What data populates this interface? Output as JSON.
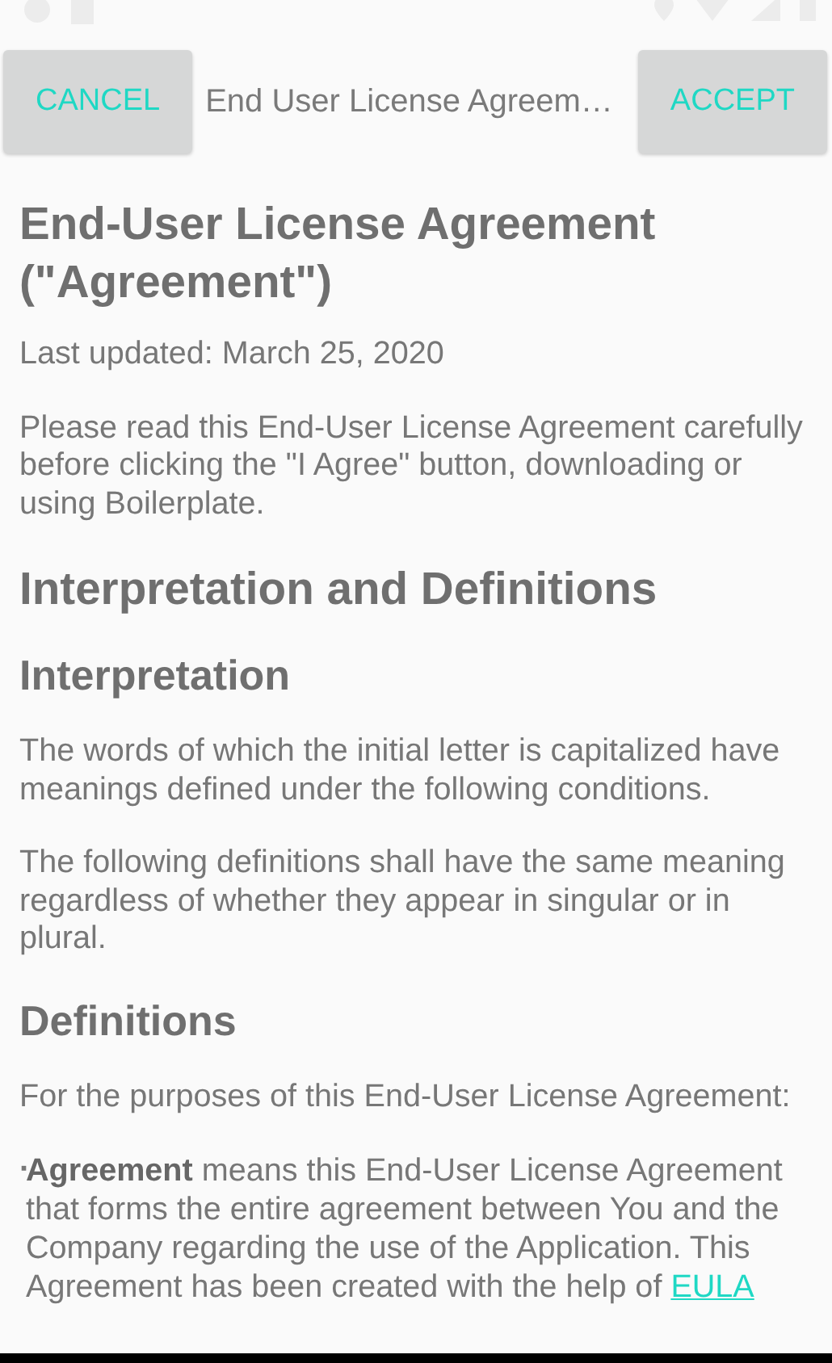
{
  "toolbar": {
    "cancel": "CANCEL",
    "title": "End User License Agreem…",
    "accept": "ACCEPT"
  },
  "document": [
    {
      "kind": "h1",
      "text": "End-User License Agreement (\"Agreement\")"
    },
    {
      "kind": "p",
      "text": "Last updated: March 25, 2020"
    },
    {
      "kind": "p",
      "text": "Please read this End-User License Agreement carefully before clicking the \"I Agree\" button, downloading or using Boilerplate."
    },
    {
      "kind": "h2",
      "text": "Interpretation and Definitions"
    },
    {
      "kind": "h3",
      "text": "Interpretation"
    },
    {
      "kind": "p",
      "text": "The words of which the initial letter is capitalized have meanings defined under the following conditions."
    },
    {
      "kind": "p",
      "text": "The following definitions shall have the same meaning regardless of whether they appear in singular or in plural."
    },
    {
      "kind": "h3",
      "text": "Definitions"
    },
    {
      "kind": "p",
      "text": "For the purposes of this End-User License Agreement:"
    },
    {
      "kind": "bullet",
      "marker": "·",
      "text": "**Agreement** means this End-User License Agreement that forms the entire agreement between You and the Company regarding the use of the Application. This Agreement has been created with the help of",
      "link": "EULA"
    }
  ]
}
